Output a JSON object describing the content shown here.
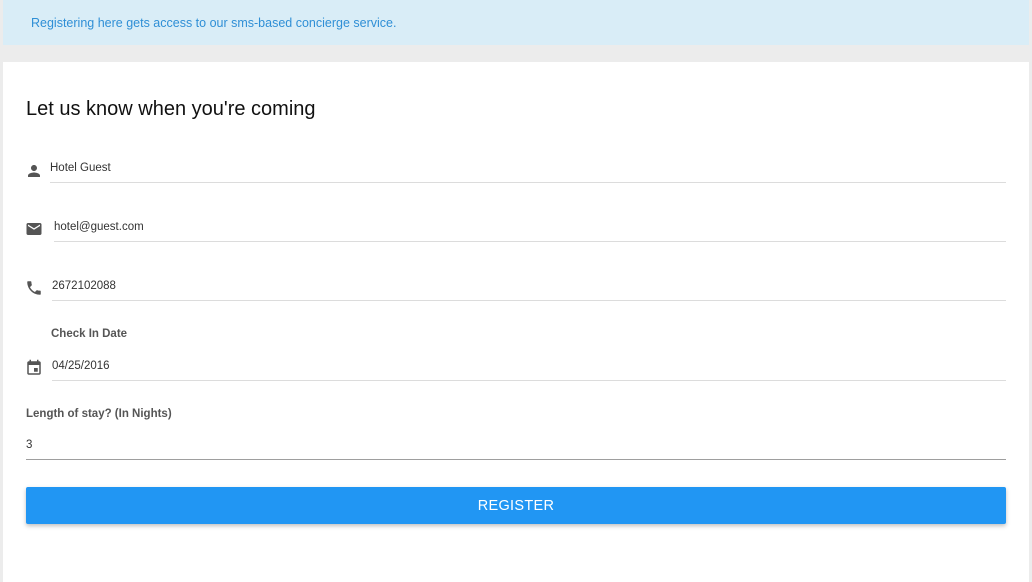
{
  "banner": {
    "text": "Registering here gets access to our sms-based concierge service."
  },
  "form": {
    "title": "Let us know when you're coming",
    "name": {
      "value": "Hotel Guest",
      "icon": "person-icon"
    },
    "email": {
      "value": "hotel@guest.com",
      "icon": "email-icon"
    },
    "phone": {
      "value": "2672102088",
      "icon": "phone-icon"
    },
    "checkin": {
      "label": "Check In Date",
      "value": "04/25/2016",
      "icon": "calendar-icon"
    },
    "stay": {
      "label": "Length of stay? (In Nights)",
      "value": "3"
    },
    "submit_label": "REGISTER"
  },
  "colors": {
    "banner_bg": "#d9edf7",
    "banner_text": "#2f8fd6",
    "button_bg": "#2196f3",
    "page_bg": "#ececec"
  }
}
